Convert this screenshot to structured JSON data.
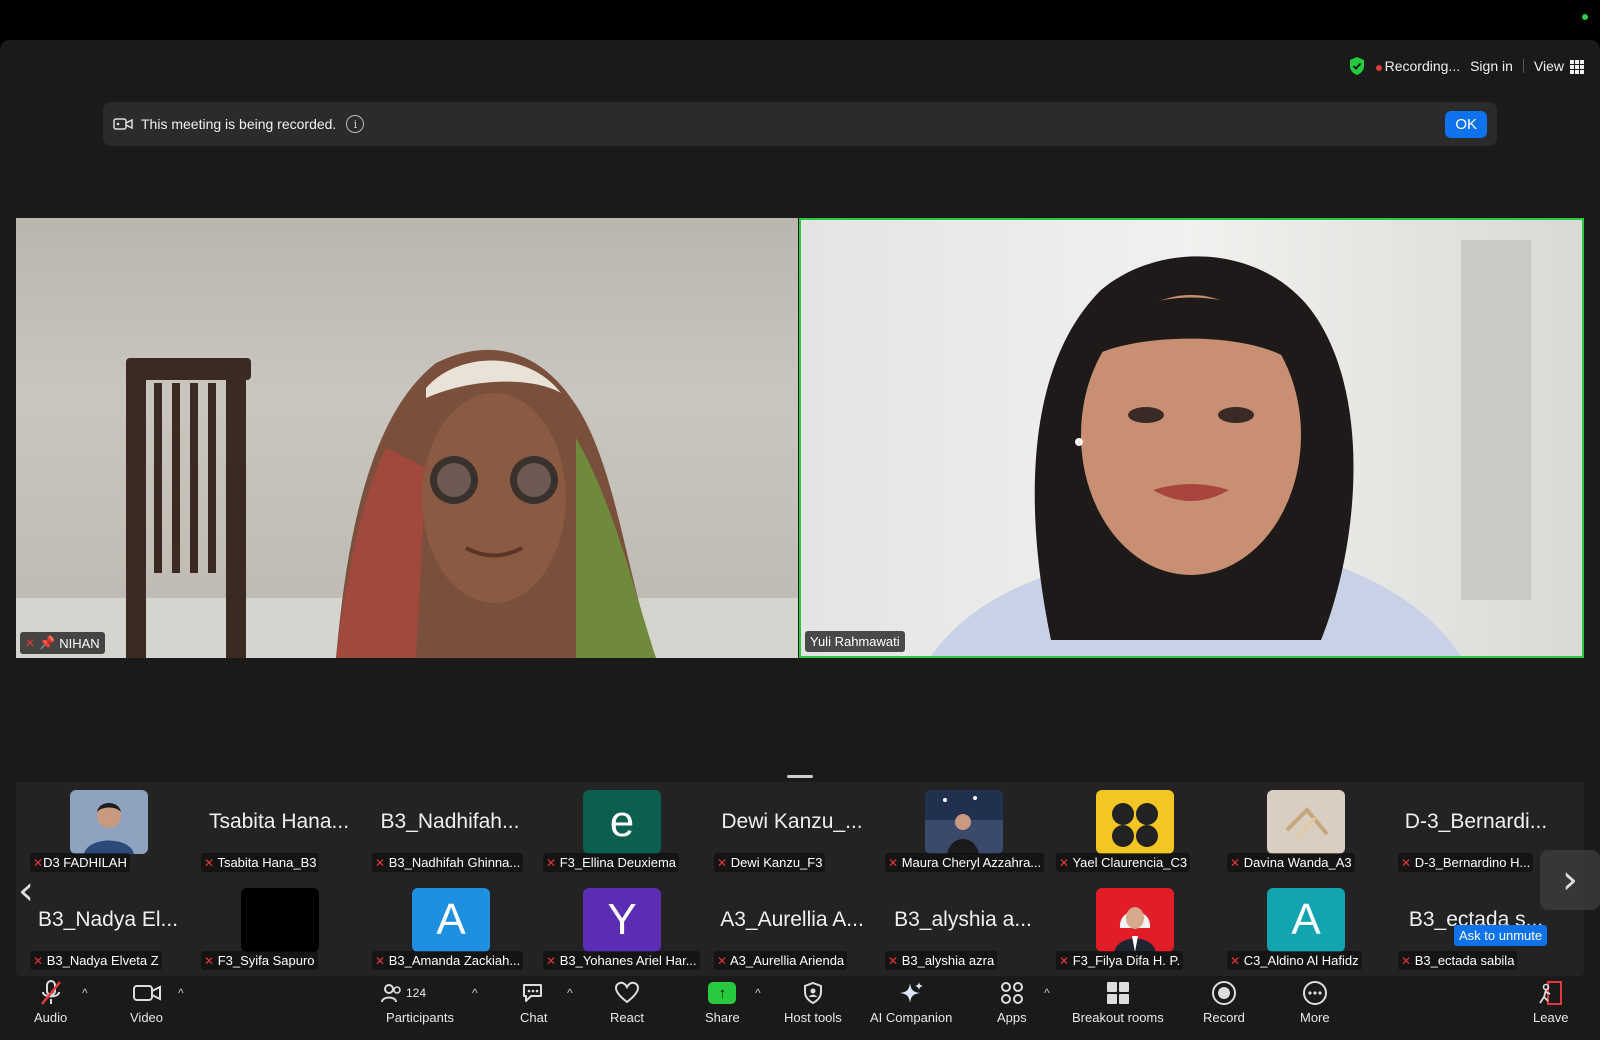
{
  "topbar": {
    "recording": "Recording...",
    "sign_in": "Sign in",
    "view": "View"
  },
  "banner": {
    "text": "This meeting is being recorded.",
    "ok": "OK"
  },
  "videos": [
    {
      "name": "NIHAN"
    },
    {
      "name": "Yuli Rahmawati"
    }
  ],
  "gallery": {
    "row1": [
      {
        "label": "D3 FADHILAH",
        "big": "",
        "avatar": "photo",
        "color": "#8fa3c0"
      },
      {
        "label": "Tsabita Hana_B3",
        "big": "Tsabita Hana...",
        "avatar": "",
        "color": ""
      },
      {
        "label": "B3_Nadhifah Ghinna...",
        "big": "B3_Nadhifah...",
        "avatar": "",
        "color": ""
      },
      {
        "label": "F3_Ellina Deuxiema",
        "big": "",
        "avatar": "e",
        "color": "#0b5e50"
      },
      {
        "label": "Dewi Kanzu_F3",
        "big": "Dewi Kanzu_...",
        "avatar": "",
        "color": ""
      },
      {
        "label": "Maura Cheryl Azzahra...",
        "big": "",
        "avatar": "photo",
        "color": "#3b4a6b"
      },
      {
        "label": "Yael Claurencia_C3",
        "big": "",
        "avatar": "photo",
        "color": "#f3c623"
      },
      {
        "label": "Davina Wanda_A3",
        "big": "",
        "avatar": "photo",
        "color": "#d8cfc2"
      },
      {
        "label": "D-3_Bernardino H...",
        "big": "D-3_Bernardi...",
        "avatar": "",
        "color": ""
      }
    ],
    "row2": [
      {
        "label": "B3_Nadya Elveta Z",
        "big": "B3_Nadya El...",
        "avatar": "",
        "color": ""
      },
      {
        "label": "F3_Syifa Sapuro",
        "big": "",
        "avatar": "photo",
        "color": "#000000"
      },
      {
        "label": "B3_Amanda Zackiah...",
        "big": "",
        "avatar": "A",
        "color": "#1f8fe0"
      },
      {
        "label": "B3_Yohanes Ariel Har...",
        "big": "",
        "avatar": "Y",
        "color": "#5a2db3"
      },
      {
        "label": "A3_Aurellia Arienda",
        "big": "A3_Aurellia A...",
        "avatar": "",
        "color": ""
      },
      {
        "label": "B3_alyshia azra",
        "big": "B3_alyshia a...",
        "avatar": "",
        "color": ""
      },
      {
        "label": "F3_Filya Difa H. P.",
        "big": "",
        "avatar": "photo",
        "color": "#e11d2a"
      },
      {
        "label": "C3_Aldino Al Hafidz",
        "big": "",
        "avatar": "A",
        "color": "#12a5b0"
      },
      {
        "label": "B3_ectada sabila",
        "big": "B3_ectada s...",
        "avatar": "",
        "color": ""
      }
    ],
    "ask_to_unmute": "Ask to unmute"
  },
  "toolbar": {
    "audio": "Audio",
    "video": "Video",
    "participants": "Participants",
    "participants_count": "124",
    "chat": "Chat",
    "react": "React",
    "share": "Share",
    "host_tools": "Host tools",
    "ai_companion": "AI Companion",
    "apps": "Apps",
    "breakout_rooms": "Breakout rooms",
    "record": "Record",
    "more": "More",
    "leave": "Leave"
  },
  "colors": {
    "accent_blue": "#0e72ed",
    "active_speaker": "#27c93f",
    "muted_red": "#e5383b"
  }
}
